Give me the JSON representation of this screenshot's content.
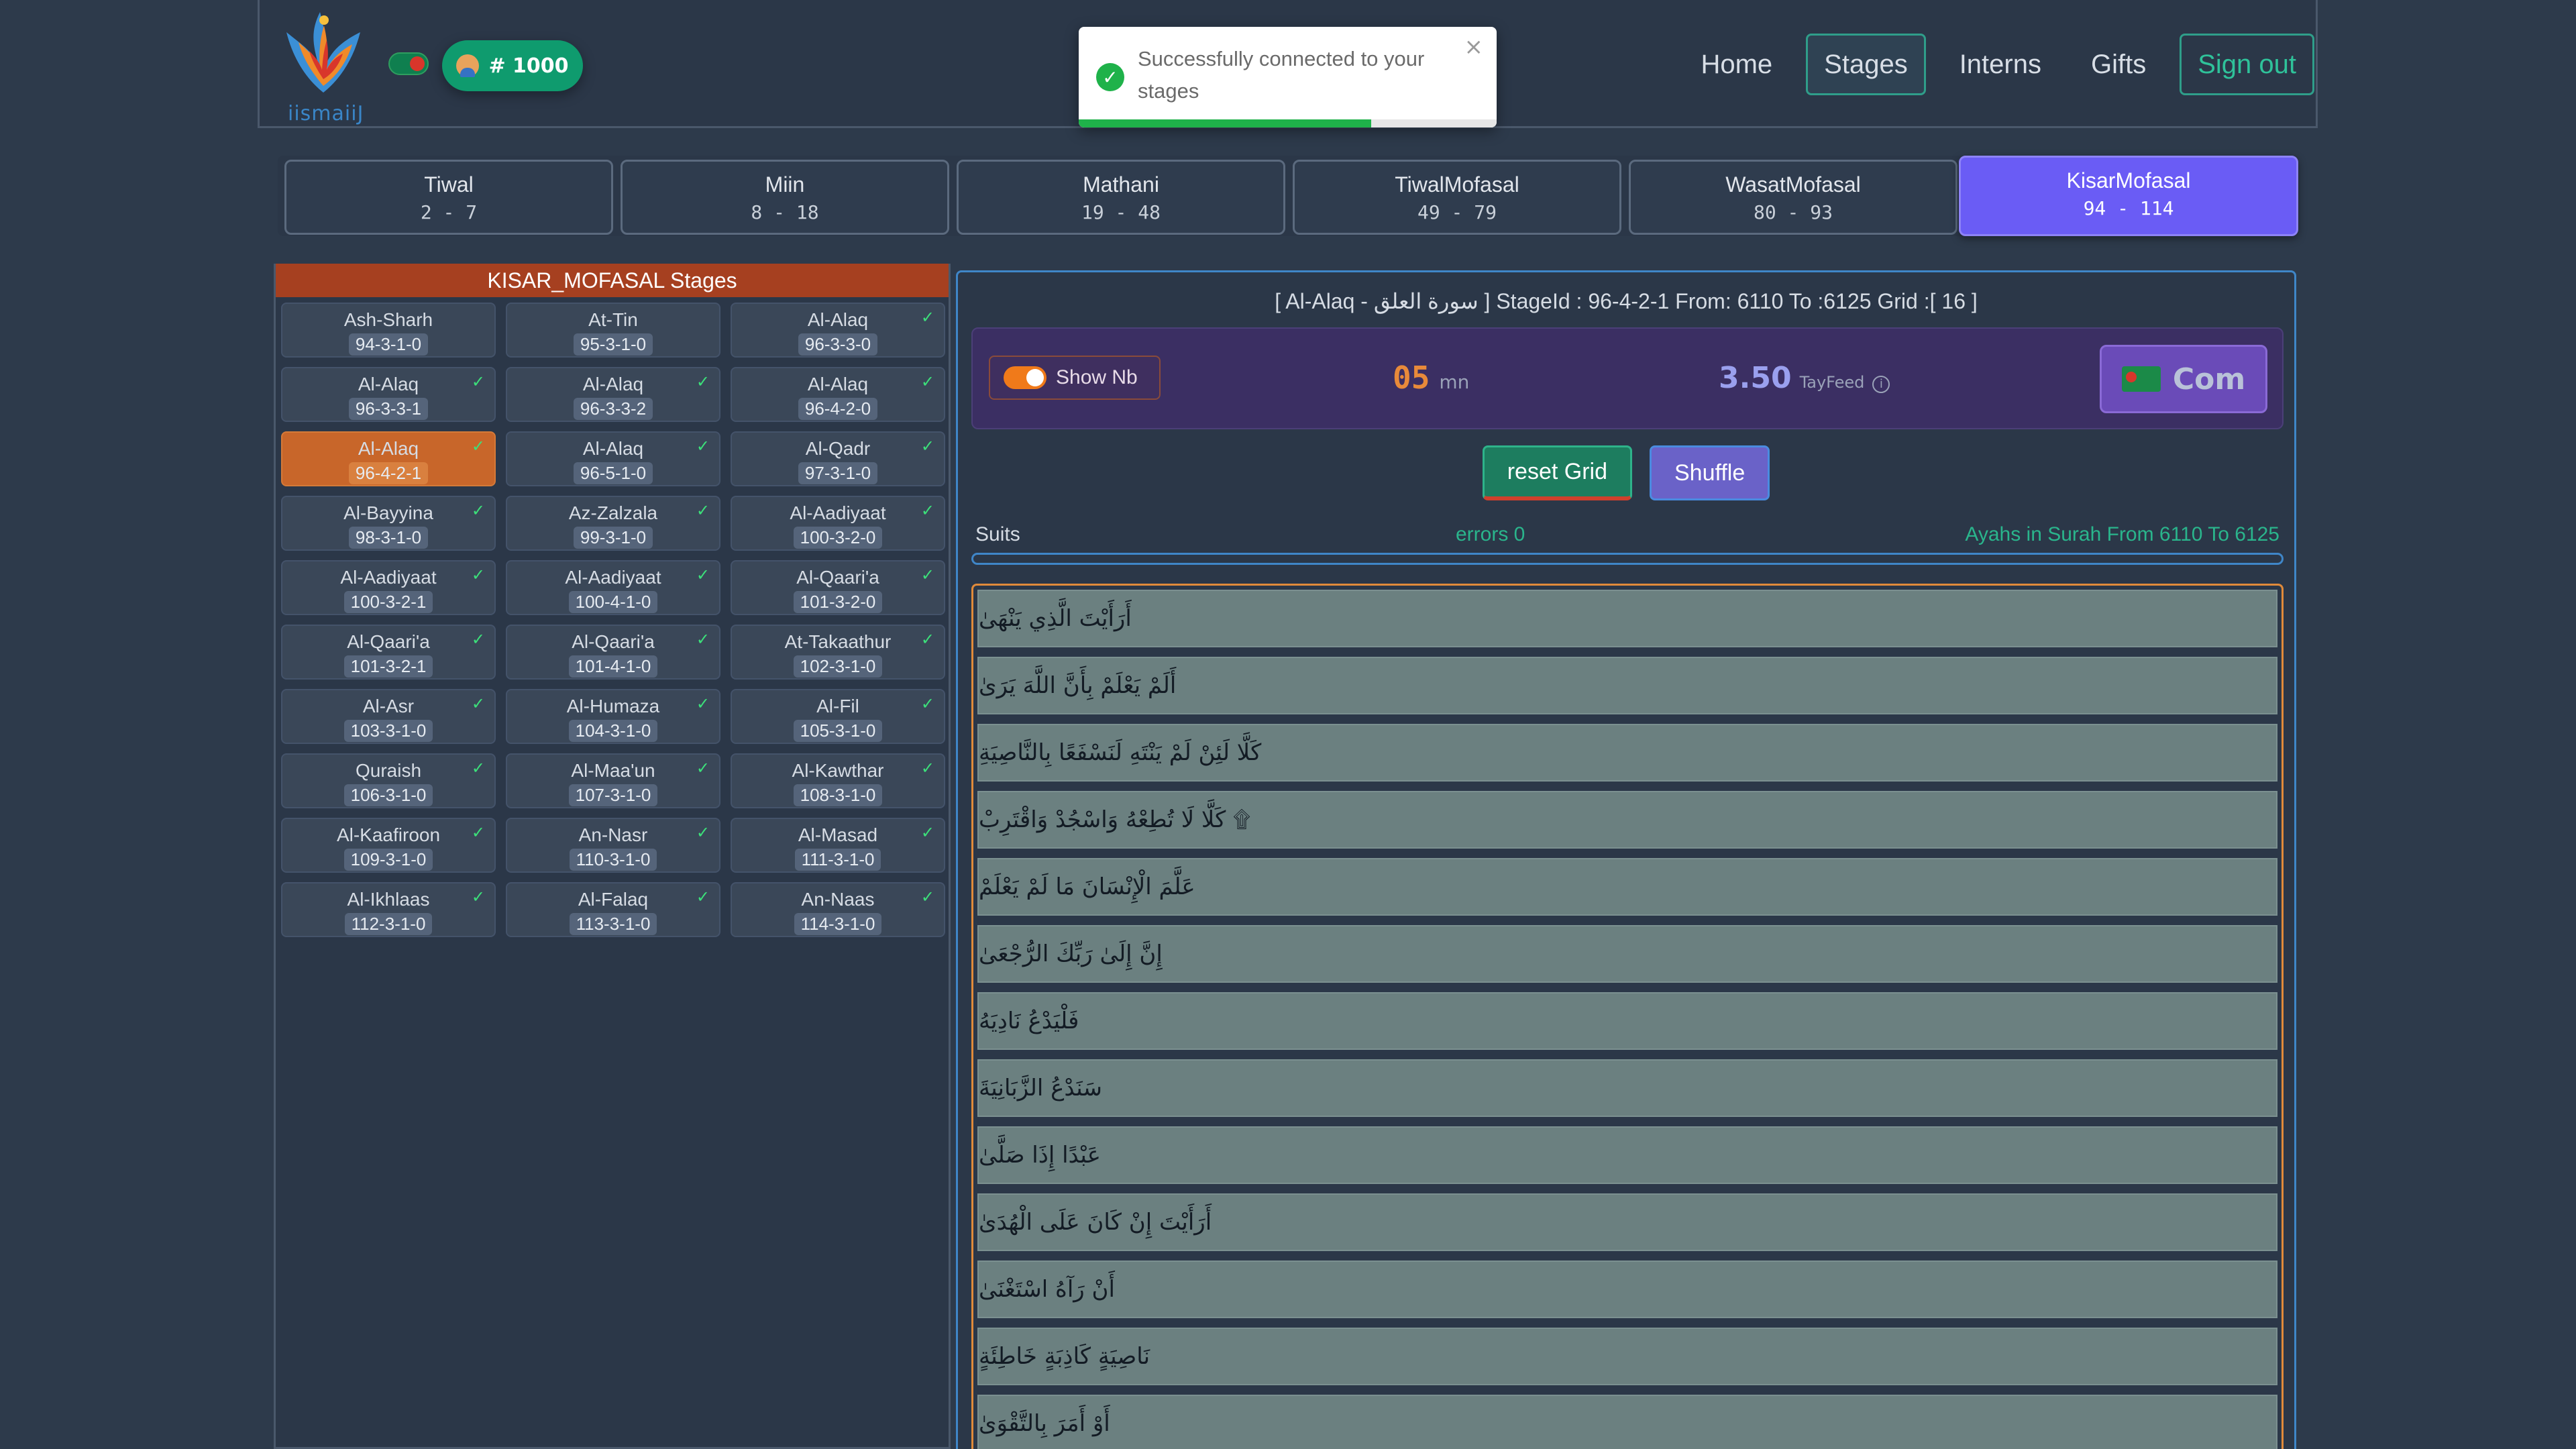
{
  "header": {
    "logo_text": "iismaiiJ",
    "badge_label": "# 1000",
    "nav": [
      "Home",
      "Stages",
      "Interns",
      "Gifts",
      "Sign out"
    ]
  },
  "toast": {
    "message": "Successfully connected to your stages",
    "close": "×",
    "progress": 0.7
  },
  "categories": [
    {
      "name": "Tiwal",
      "range": "2 - 7"
    },
    {
      "name": "Miin",
      "range": "8 - 18"
    },
    {
      "name": "Mathani",
      "range": "19 - 48"
    },
    {
      "name": "TiwalMofasal",
      "range": "49 - 79"
    },
    {
      "name": "WasatMofasal",
      "range": "80 - 93"
    },
    {
      "name": "KisarMofasal",
      "range": "94 - 114"
    }
  ],
  "left_panel": {
    "title": "KISAR_MOFASAL Stages",
    "stages": [
      {
        "name": "Ash-Sharh",
        "id": "94-3-1-0",
        "done": false
      },
      {
        "name": "At-Tin",
        "id": "95-3-1-0",
        "done": false
      },
      {
        "name": "Al-Alaq",
        "id": "96-3-3-0",
        "done": true
      },
      {
        "name": "Al-Alaq",
        "id": "96-3-3-1",
        "done": true
      },
      {
        "name": "Al-Alaq",
        "id": "96-3-3-2",
        "done": true
      },
      {
        "name": "Al-Alaq",
        "id": "96-4-2-0",
        "done": true
      },
      {
        "name": "Al-Alaq",
        "id": "96-4-2-1",
        "done": true,
        "active": true
      },
      {
        "name": "Al-Alaq",
        "id": "96-5-1-0",
        "done": true
      },
      {
        "name": "Al-Qadr",
        "id": "97-3-1-0",
        "done": true
      },
      {
        "name": "Al-Bayyina",
        "id": "98-3-1-0",
        "done": true
      },
      {
        "name": "Az-Zalzala",
        "id": "99-3-1-0",
        "done": true
      },
      {
        "name": "Al-Aadiyaat",
        "id": "100-3-2-0",
        "done": true
      },
      {
        "name": "Al-Aadiyaat",
        "id": "100-3-2-1",
        "done": true
      },
      {
        "name": "Al-Aadiyaat",
        "id": "100-4-1-0",
        "done": true
      },
      {
        "name": "Al-Qaari'a",
        "id": "101-3-2-0",
        "done": true
      },
      {
        "name": "Al-Qaari'a",
        "id": "101-3-2-1",
        "done": true
      },
      {
        "name": "Al-Qaari'a",
        "id": "101-4-1-0",
        "done": true
      },
      {
        "name": "At-Takaathur",
        "id": "102-3-1-0",
        "done": true
      },
      {
        "name": "Al-Asr",
        "id": "103-3-1-0",
        "done": true
      },
      {
        "name": "Al-Humaza",
        "id": "104-3-1-0",
        "done": true
      },
      {
        "name": "Al-Fil",
        "id": "105-3-1-0",
        "done": true
      },
      {
        "name": "Quraish",
        "id": "106-3-1-0",
        "done": true
      },
      {
        "name": "Al-Maa'un",
        "id": "107-3-1-0",
        "done": true
      },
      {
        "name": "Al-Kawthar",
        "id": "108-3-1-0",
        "done": true
      },
      {
        "name": "Al-Kaafiroon",
        "id": "109-3-1-0",
        "done": true
      },
      {
        "name": "An-Nasr",
        "id": "110-3-1-0",
        "done": true
      },
      {
        "name": "Al-Masad",
        "id": "111-3-1-0",
        "done": true
      },
      {
        "name": "Al-Ikhlaas",
        "id": "112-3-1-0",
        "done": true
      },
      {
        "name": "Al-Falaq",
        "id": "113-3-1-0",
        "done": true
      },
      {
        "name": "An-Naas",
        "id": "114-3-1-0",
        "done": true
      }
    ]
  },
  "right_panel": {
    "stage_info": "[ Al-Alaq - سورة العلق ] StageId : 96-4-2-1  From: 6110   To :6125   Grid :[ 16 ]",
    "show_nb_label": "Show Nb",
    "timer_value": "05",
    "timer_unit": "mn",
    "tayfeed_value": "3.50",
    "tayfeed_label": "TayFeed",
    "info_icon_glyph": "i",
    "com_label": "Com",
    "reset_label": "reset Grid",
    "shuffle_label": "Shuffle",
    "suits_label": "Suits",
    "errors_label": "errors  0",
    "ayahs_label": "Ayahs in Surah   From 6110 To 6125",
    "ayahs": [
      "أَرَأَيْتَ الَّذِي يَنْهَىٰ",
      "أَلَمْ يَعْلَمْ بِأَنَّ اللَّهَ يَرَىٰ",
      "كَلَّا لَئِنْ لَمْ يَنْتَهِ لَنَسْفَعًا بِالنَّاصِيَةِ",
      "۩ كَلَّا لَا تُطِعْهُ وَاسْجُدْ وَاقْتَرِبْ",
      "عَلَّمَ الْإِنْسَانَ مَا لَمْ يَعْلَمْ",
      "إِنَّ إِلَىٰ رَبِّكَ الرُّجْعَىٰ",
      "فَلْيَدْعُ نَادِيَهُ",
      "سَنَدْعُ الزَّبَانِيَةَ",
      "عَبْدًا إِذَا صَلَّىٰ",
      "أَرَأَيْتَ إِنْ كَانَ عَلَى الْهُدَىٰ",
      "أَنْ رَآهُ اسْتَغْنَىٰ",
      "نَاصِيَةٍ كَاذِبَةٍ خَاطِئَةٍ",
      "أَوْ أَمَرَ بِالتَّقْوَىٰ"
    ]
  },
  "colors": {
    "accent": "#6a5cf5",
    "stage_active": "#c8662a",
    "success": "#1fb24a",
    "header_title": "#a64020"
  }
}
